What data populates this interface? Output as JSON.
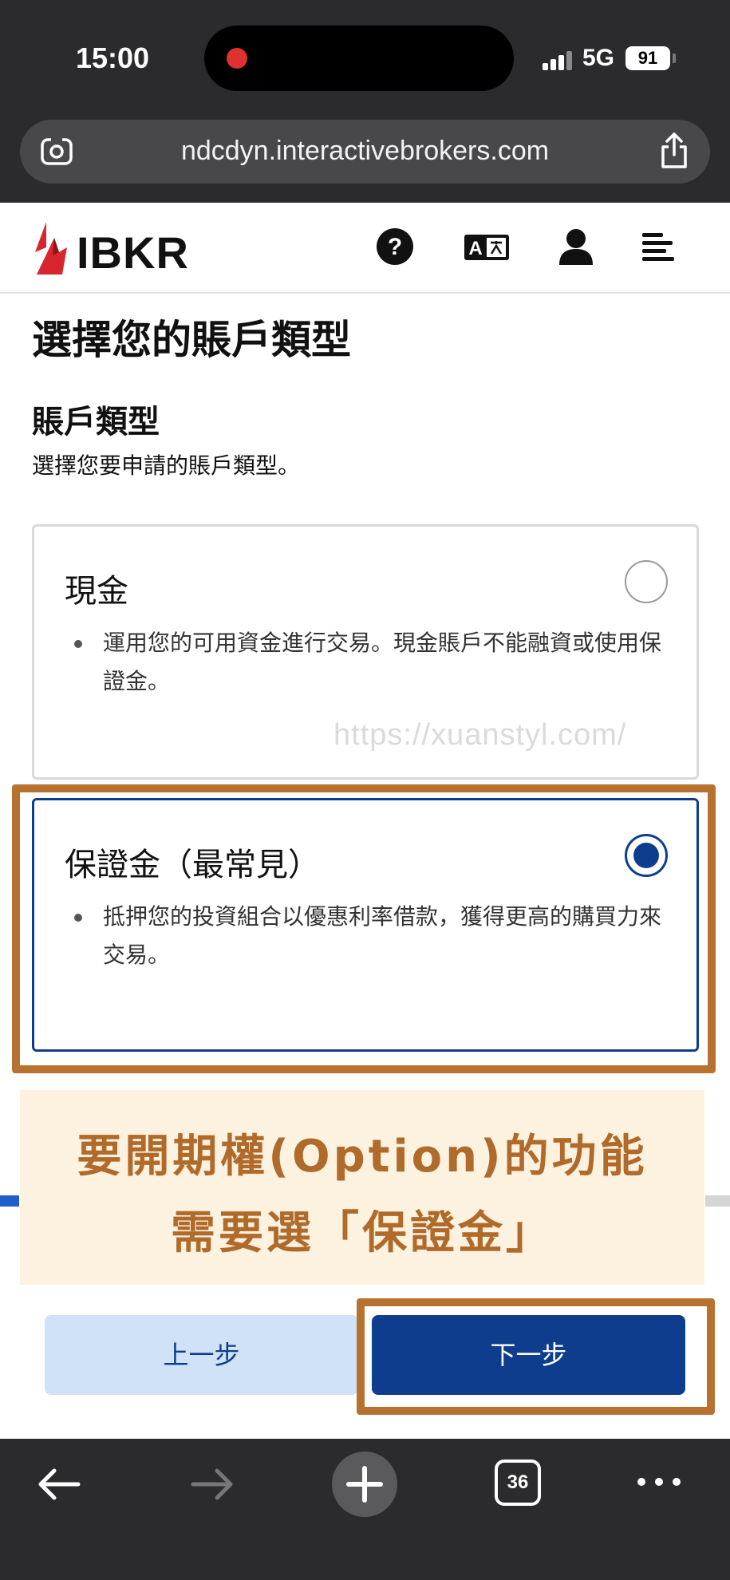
{
  "status_bar": {
    "time": "15:00",
    "network": "5G",
    "battery": "91"
  },
  "browser": {
    "url": "ndcdyn.interactivebrokers.com",
    "tab_count": "36"
  },
  "header": {
    "logo_text": "IBKR",
    "icons": [
      "help-icon",
      "language-icon",
      "user-icon",
      "menu-icon"
    ]
  },
  "page": {
    "title": "選擇您的賬戶類型",
    "section_title": "賬戶類型",
    "section_subtitle": "選擇您要申請的賬戶類型。"
  },
  "options": [
    {
      "title": "現金",
      "description": "運用您的可用資金進行交易。現金賬戶不能融資或使用保證金。",
      "selected": false
    },
    {
      "title": "保證金（最常見）",
      "description": "抵押您的投資組合以優惠利率借款，獲得更高的購買力來交易。",
      "selected": true
    }
  ],
  "watermark": "https://xuanstyl.com/",
  "annotation": {
    "line1": "要開期權(Option)的功能",
    "line2": "需要選「保證金」"
  },
  "buttons": {
    "prev": "上一步",
    "next": "下一步"
  },
  "colors": {
    "brand_blue": "#0d3d8c",
    "logo_red": "#d7262e",
    "annotation_brown": "#b8722f"
  }
}
